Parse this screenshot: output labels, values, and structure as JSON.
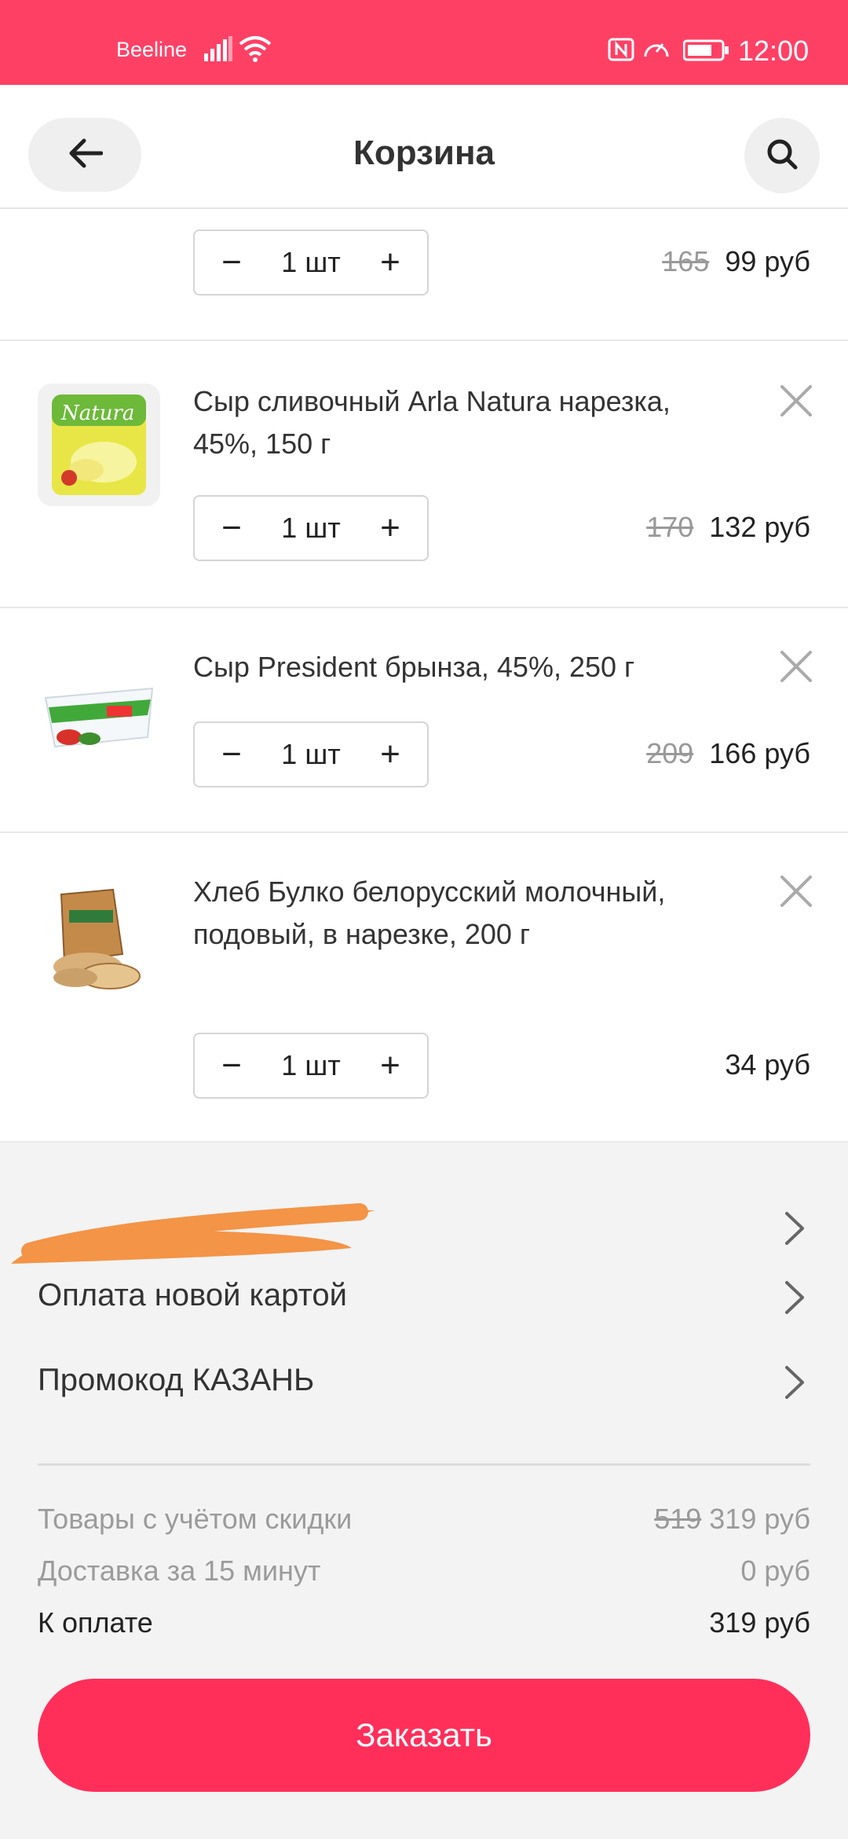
{
  "status_bar": {
    "carrier": "Beeline",
    "time": "12:00",
    "icons": [
      "signal-icon",
      "wifi-icon",
      "nfc-icon",
      "speed-icon",
      "battery-icon"
    ]
  },
  "header": {
    "title": "Корзина",
    "back_icon": "arrow-left-icon",
    "search_icon": "search-icon"
  },
  "cart": {
    "items": [
      {
        "name": "",
        "qty": "1 шт",
        "old_price": "165",
        "price": "99 руб"
      },
      {
        "name": "Сыр сливочный Arla Natura нарезка, 45%, 150 г",
        "image_text": "Natura",
        "qty": "1 шт",
        "old_price": "170",
        "price": "132 руб"
      },
      {
        "name": "Сыр President брынза, 45%, 250 г",
        "qty": "1 шт",
        "old_price": "209",
        "price": "166 руб"
      },
      {
        "name": "Хлеб Булко белорусский молочный, подовый, в нарезке, 200 г",
        "qty": "1 шт",
        "old_price": "",
        "price": "34 руб"
      }
    ],
    "minus_symbol": "−",
    "plus_symbol": "+"
  },
  "options": {
    "payment_new_card": "Оплата новой картой",
    "promo_code": "Промокод КАЗАНЬ"
  },
  "summary": {
    "goods_label": "Товары с учётом скидки",
    "goods_old": "519",
    "goods_price": "319 руб",
    "delivery_label": "Доставка за 15 минут",
    "delivery_price": "0 руб",
    "total_label": "К оплате",
    "total_price": "319 руб"
  },
  "order_button": "Заказать",
  "colors": {
    "accent": "#ff4065",
    "button": "#ff2f5a",
    "redaction": "#f39447"
  }
}
